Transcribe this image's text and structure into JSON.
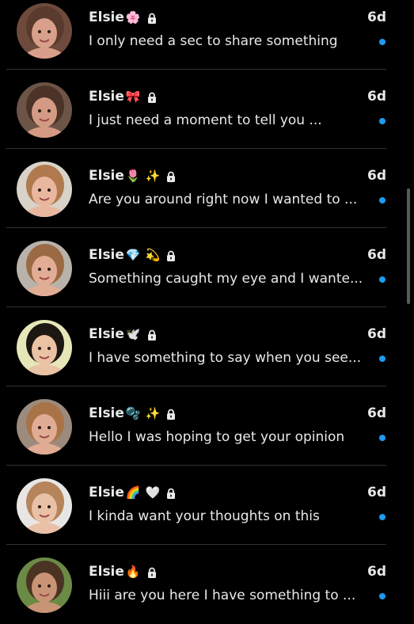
{
  "conversations": [
    {
      "name": "Elsie",
      "emojis": [
        "🌸"
      ],
      "time": "6d",
      "preview": "I only need a sec to share something",
      "avatar_bg": "#6d4a3b",
      "skin": "#d8a08a",
      "hair": "#5a3a2c"
    },
    {
      "name": "Elsie",
      "emojis": [
        "🎀"
      ],
      "time": "6d",
      "preview": "I just need a moment to tell you ...",
      "avatar_bg": "#6c5446",
      "skin": "#d49a84",
      "hair": "#4b3328"
    },
    {
      "name": "Elsie",
      "emojis": [
        "🌷",
        "✨"
      ],
      "time": "6d",
      "preview": "Are you around right now I wanted to ...",
      "avatar_bg": "#d8d2c8",
      "skin": "#e8b79e",
      "hair": "#b07a4e"
    },
    {
      "name": "Elsie",
      "emojis": [
        "💎",
        "💫"
      ],
      "time": "6d",
      "preview": "Something caught my eye and I wante...",
      "avatar_bg": "#b8b2aa",
      "skin": "#e2ad95",
      "hair": "#9a6a44"
    },
    {
      "name": "Elsie",
      "emojis": [
        "🕊️"
      ],
      "time": "6d",
      "preview": "I have something to say when you see...",
      "avatar_bg": "#e6e6b8",
      "skin": "#eac2a4",
      "hair": "#1d1712"
    },
    {
      "name": "Elsie",
      "emojis": [
        "🫧",
        "✨"
      ],
      "time": "6d",
      "preview": "Hello I was hoping to get your opinion",
      "avatar_bg": "#9c8a7c",
      "skin": "#e1ac94",
      "hair": "#a97347"
    },
    {
      "name": "Elsie",
      "emojis": [
        "🌈",
        "🤍"
      ],
      "time": "6d",
      "preview": "I kinda want your thoughts on this",
      "avatar_bg": "#e8e6e4",
      "skin": "#e9c1a7",
      "hair": "#b5845a"
    },
    {
      "name": "Elsie",
      "emojis": [
        "🔥"
      ],
      "time": "6d",
      "preview": "Hiii are you here I have something to ...",
      "avatar_bg": "#6b8a45",
      "skin": "#c99475",
      "hair": "#4a3322"
    }
  ],
  "colors": {
    "background": "#000000",
    "text": "#e7e9ea",
    "unread_dot": "#1d9bf0",
    "divider": "#2f3336"
  },
  "icons": {
    "lock": "lock-icon",
    "unread": "unread-dot"
  }
}
